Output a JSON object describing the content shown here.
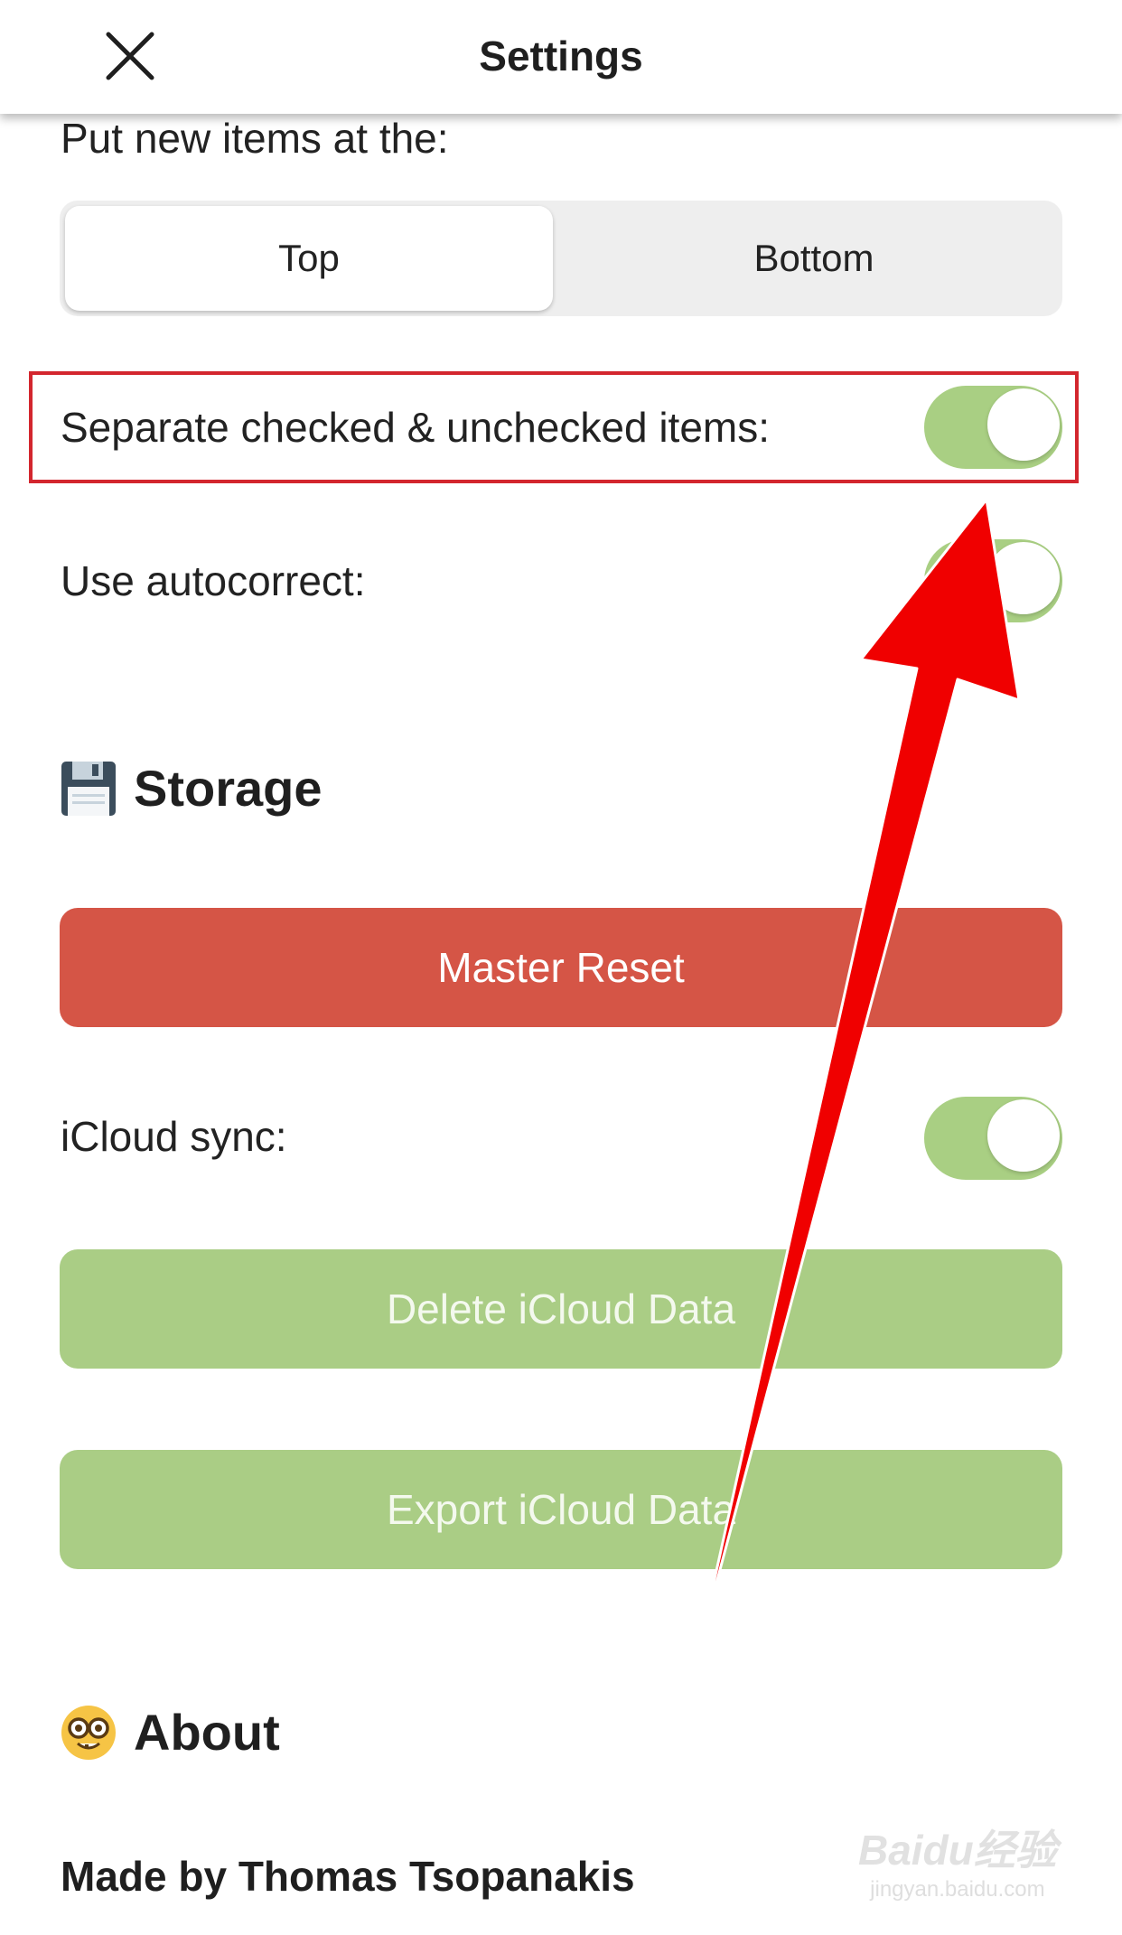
{
  "header": {
    "title": "Settings",
    "close_icon": "close-icon"
  },
  "lists": {
    "new_items_label": "Put new items at the:",
    "position_options": [
      "Top",
      "Bottom"
    ],
    "position_selected": "Top",
    "separate_label": "Separate checked & unchecked items:",
    "separate_on": true,
    "autocorrect_label": "Use autocorrect:",
    "autocorrect_on": true
  },
  "storage": {
    "icon": "floppy-disk-icon",
    "title": "Storage",
    "master_reset_label": "Master Reset",
    "icloud_sync_label": "iCloud sync:",
    "icloud_sync_on": true,
    "delete_label": "Delete iCloud Data",
    "export_label": "Export iCloud Data"
  },
  "about": {
    "icon": "nerd-face-icon",
    "title": "About",
    "made_by": "Made by Thomas Tsopanakis"
  },
  "watermark": {
    "text": "Baidu经验",
    "url": "jingyan.baidu.com"
  },
  "colors": {
    "accent_green": "#a9cf83",
    "reset_red": "#d55546",
    "highlight_red": "#d3262e",
    "arrow_red": "#f00000"
  }
}
